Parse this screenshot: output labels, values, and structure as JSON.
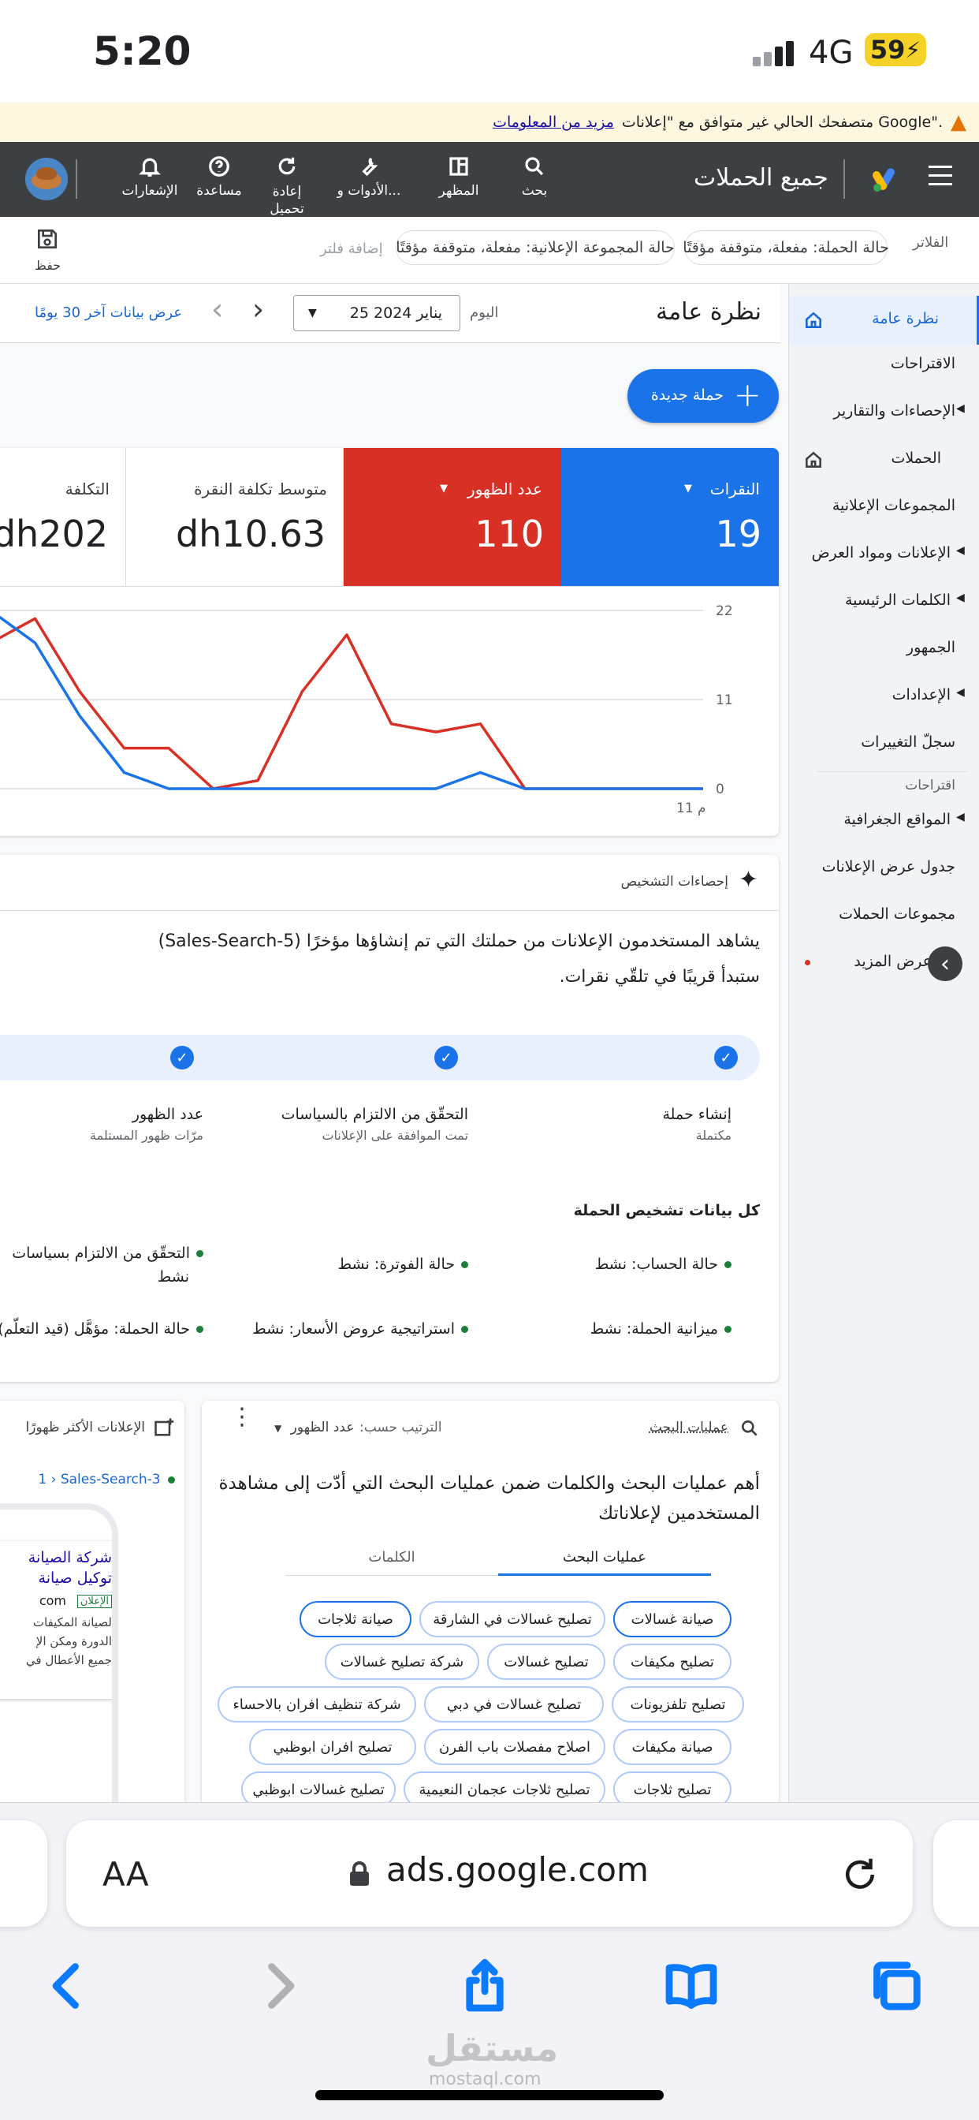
{
  "status_bar": {
    "time": "5:20",
    "network": "4G",
    "battery": "59"
  },
  "warning": {
    "text": "متصفحك الحالي غير متوافق مع \"إعلانات Google\".",
    "link": "مزيد من المعلومات"
  },
  "header": {
    "title": "جميع الحملات",
    "items": [
      {
        "label": "بحث",
        "icon": "search-icon"
      },
      {
        "label": "المظهر",
        "icon": "appearance-icon"
      },
      {
        "label": "الأدوات و...",
        "icon": "wrench-icon"
      },
      {
        "label": "إعادة تحميل",
        "icon": "refresh-icon"
      },
      {
        "label": "مساعدة",
        "icon": "help-icon"
      },
      {
        "label": "الإشعارات",
        "icon": "bell-icon"
      }
    ]
  },
  "filters": {
    "label": "الفلاتر",
    "chips": [
      "حالة الحملة: مفعلة، متوقفة مؤقتًا",
      "حالة المجموعة الإعلانية: مفعلة، متوقفة مؤقتًا"
    ],
    "add": "إضافة فلتر",
    "save": "حفظ"
  },
  "sidebar": {
    "items": [
      "نظرة عامة",
      "الاقتراحات",
      "الإحصاءات والتقارير",
      "الحملات",
      "المجموعات الإعلانية",
      "الإعلانات ومواد العرض",
      "الكلمات الرئيسية",
      "الجمهور",
      "الإعدادات",
      "سجلّ التغييرات"
    ],
    "section": "اقتراحات",
    "suggestions": [
      "المواقع الجغرافية",
      "جدول عرض الإعلانات",
      "مجموعات الحملات",
      "عرض المزيد"
    ]
  },
  "overview": {
    "title": "نظرة عامة",
    "today": "اليوم",
    "date": "25 يناير 2024",
    "last30": "عرض بيانات آخر 30 يومًا",
    "new_campaign": "حملة جديدة"
  },
  "metrics": [
    {
      "label": "النقرات",
      "value": "19",
      "color": "#1a73e8"
    },
    {
      "label": "عدد الظهور",
      "value": "110",
      "color": "#d93025"
    },
    {
      "label": "متوسط تكلفة النقرة",
      "value": "dh10.63"
    },
    {
      "label": "التكلفة",
      "value": "dh202"
    }
  ],
  "chart_data": {
    "type": "line",
    "y_ticks": [
      "22",
      "11",
      "0"
    ],
    "x_label": "11 م",
    "ylim": [
      0,
      22
    ],
    "series": [
      {
        "color": "#d93025",
        "values": [
          18,
          21,
          12,
          5,
          5,
          0,
          1,
          12,
          19,
          8,
          7,
          8,
          0,
          0,
          0,
          0,
          0
        ]
      },
      {
        "color": "#1a73e8",
        "values": [
          22,
          18,
          9,
          2,
          0,
          0,
          0,
          0,
          0,
          0,
          0,
          2,
          0,
          0,
          0,
          0,
          0
        ]
      }
    ]
  },
  "diagnostics": {
    "header": "إحصاءات التشخيص",
    "message_line1": "يشاهد المستخدمون الإعلانات من حملتك التي تم إنشاؤها مؤخرًا (Sales-Search-5)",
    "message_line2": "ستبدأ قريبًا في تلقّي نقرات.",
    "steps": [
      {
        "title": "إنشاء حملة",
        "sub": "مكتملة"
      },
      {
        "title": "التحقّق من الالتزام بالسياسات",
        "sub": "تمت الموافقة على الإعلانات"
      },
      {
        "title": "عدد الظهور",
        "sub": "مرّات ظهور المستلمة"
      }
    ],
    "all_title": "كل بيانات تشخيص الحملة",
    "items": [
      "حالة الحساب: نشط",
      "حالة الفوترة: نشط",
      "التحقّق من الالتزام بسياسات",
      "نشط",
      "ميزانية الحملة: نشط",
      "استراتيجية عروض الأسعار: نشط",
      "حالة الحملة: مؤهَّل (قيد التعلّم)"
    ]
  },
  "search_card": {
    "header": "عمليات البحث",
    "sort_label": "الترتيب حسب:",
    "sort_value": "عدد الظهور",
    "title_line1": "أهم عمليات البحث والكلمات ضمن عمليات البحث التي أدّت إلى مشاهدة",
    "title_line2": "المستخدمين لإعلاناتك",
    "tabs": [
      "عمليات البحث",
      "الكلمات"
    ],
    "terms": [
      "صيانة غسالات",
      "تصليح غسالات في الشارقة",
      "صيانة ثلاجات",
      "تصليح مكيفات",
      "تصليح غسالات",
      "شركة تصليح غسالات",
      "تصليح تلفزيونات",
      "تصليح غسالات في دبي",
      "شركة تنظيف افران بالاحساء",
      "صيانة مكيفات",
      "اصلاح مفصلات باب الفرن",
      "تصليح افران ابوظبي",
      "تصليح ثلاجات",
      "تصليح ثلاجات عجمان النعيمية",
      "تصليح غسالات ابوظبي"
    ]
  },
  "ads_card": {
    "header": "الإعلانات الأكثر ظهورًا",
    "campaign": "Sales-Search-3",
    "prefix": "1",
    "ad_line1": "شركة الصيانة",
    "ad_line2": "توكيل صيانة",
    "ad_badge": "الإعلان",
    "ad_url": "com",
    "ad_desc1": "لصيانة المكيفات",
    "ad_desc2": "الدورة ومكن الإ",
    "ad_desc3": "جميع الأعطال في"
  },
  "safari": {
    "text_size": "AA",
    "url": "ads.google.com"
  },
  "watermark": "مستقل",
  "watermark_sub": "mostaql.com"
}
